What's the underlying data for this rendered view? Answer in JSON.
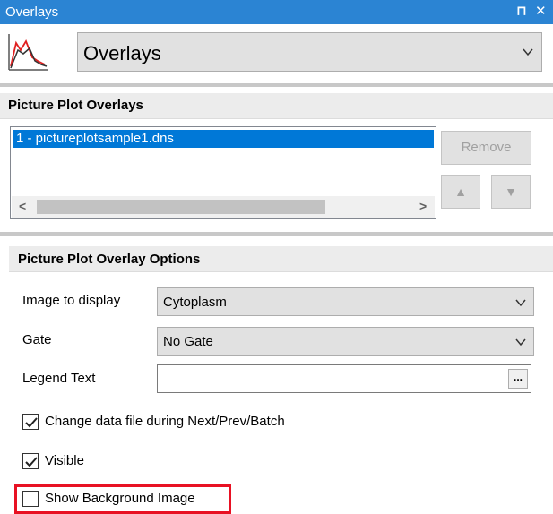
{
  "titlebar": {
    "title": "Overlays",
    "pin_icon": "pin-icon",
    "close_icon": "close-icon",
    "pin_glyph": "⊓",
    "close_glyph": "✕"
  },
  "overlays_selector": {
    "value": "Overlays",
    "icon": "overlay-plot-icon"
  },
  "picture_plot_overlays": {
    "header": "Picture Plot Overlays",
    "items": [
      "1 - pictureplotsample1.dns"
    ],
    "scroll_left": "<",
    "scroll_right": ">",
    "remove_label": "Remove",
    "up_glyph": "▲",
    "down_glyph": "▼"
  },
  "options": {
    "header": "Picture Plot Overlay Options",
    "image_label": "Image to display",
    "image_value": "Cytoplasm",
    "gate_label": "Gate",
    "gate_value": "No Gate",
    "legend_label": "Legend Text",
    "legend_value": "",
    "ellipsis": "...",
    "change_data_label": "Change data file during Next/Prev/Batch",
    "change_data_checked": true,
    "visible_label": "Visible",
    "visible_checked": true,
    "show_bg_label": "Show Background Image",
    "show_bg_checked": false
  },
  "colors": {
    "titlebar": "#2b84d3",
    "selection": "#0078d7",
    "highlight": "#e81123"
  }
}
